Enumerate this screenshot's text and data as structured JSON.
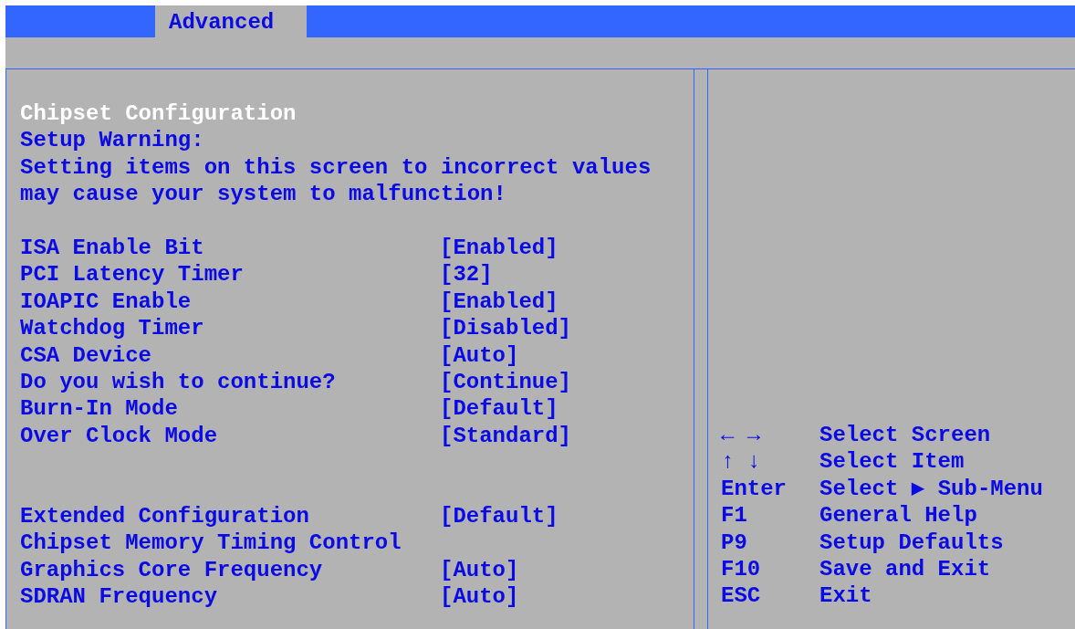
{
  "tabs": [
    {
      "label": "Advanced",
      "selected": true
    }
  ],
  "heading": "Chipset Configuration",
  "warning": {
    "title": "Setup Warning:",
    "lines": [
      "Setting items on this screen to incorrect values",
      "may cause your system to malfunction!"
    ]
  },
  "setting_groups": [
    [
      {
        "label": "ISA Enable Bit",
        "value": "[Enabled]"
      },
      {
        "label": "PCI Latency Timer",
        "value": "[32]"
      },
      {
        "label": "IOAPIC Enable",
        "value": "[Enabled]"
      },
      {
        "label": "Watchdog Timer",
        "value": "[Disabled]"
      },
      {
        "label": "CSA Device",
        "value": "[Auto]"
      },
      {
        "label": "Do you wish to continue?",
        "value": "[Continue]"
      },
      {
        "label": "Burn-In Mode",
        "value": "[Default]"
      },
      {
        "label": "Over Clock Mode",
        "value": "[Standard]"
      }
    ],
    [
      {
        "label": "Extended Configuration",
        "value": "[Default]"
      },
      {
        "label": "Chipset Memory Timing Control"
      },
      {
        "label": "Graphics Core Frequency",
        "value": "[Auto]"
      },
      {
        "label": "SDRAN Frequency",
        "value": "[Auto]"
      }
    ]
  ],
  "key_help": [
    {
      "key": "← →",
      "action": "Select Screen"
    },
    {
      "key": "↑ ↓",
      "action": "Select Item"
    },
    {
      "key": "Enter",
      "action": "Select ▶ Sub-Menu"
    },
    {
      "key": "F1",
      "action": "General Help"
    },
    {
      "key": "P9",
      "action": "Setup Defaults"
    },
    {
      "key": "F10",
      "action": "Save and Exit"
    },
    {
      "key": "ESC",
      "action": "Exit"
    }
  ]
}
